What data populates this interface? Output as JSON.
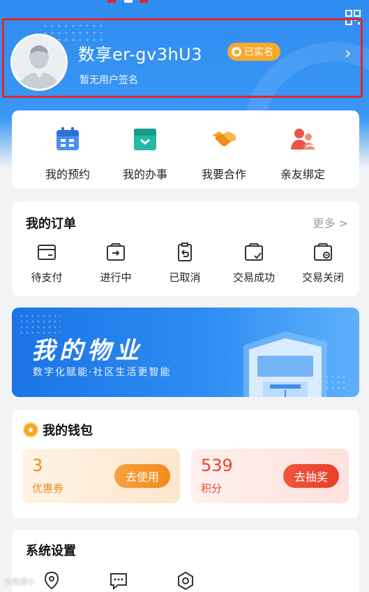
{
  "profile": {
    "name": "数享er-gv3hU3",
    "verified_badge": "已实名",
    "signature": "暂无用户签名"
  },
  "quick_actions": [
    {
      "label": "我的预约",
      "icon": "calendar-icon"
    },
    {
      "label": "我的办事",
      "icon": "folder-box-icon"
    },
    {
      "label": "我要合作",
      "icon": "handshake-icon"
    },
    {
      "label": "亲友绑定",
      "icon": "family-bind-icon"
    }
  ],
  "orders": {
    "title": "我的订单",
    "more": "更多 >",
    "items": [
      {
        "label": "待支付",
        "icon": "card-icon"
      },
      {
        "label": "进行中",
        "icon": "arrow-box-icon"
      },
      {
        "label": "已取消",
        "icon": "cancel-doc-icon"
      },
      {
        "label": "交易成功",
        "icon": "success-box-icon"
      },
      {
        "label": "交易关闭",
        "icon": "closed-box-icon"
      }
    ]
  },
  "banner": {
    "title": "我的物业",
    "subtitle": "数字化赋能·社区生活更智能"
  },
  "wallet": {
    "title": "我的钱包",
    "coupon": {
      "value": "3",
      "label": "优惠券",
      "button": "去使用"
    },
    "points": {
      "value": "539",
      "label": "积分",
      "button": "去抽奖"
    }
  },
  "settings": {
    "title": "系统设置"
  },
  "watermark": "大数据小"
}
